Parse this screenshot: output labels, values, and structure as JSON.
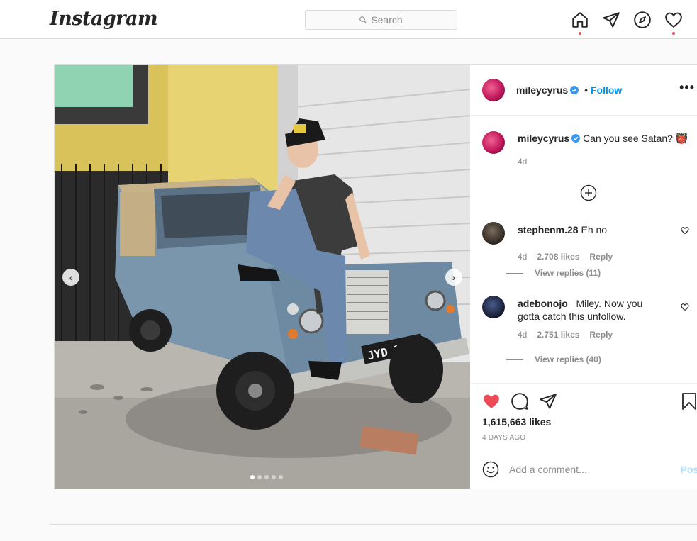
{
  "header": {
    "logo": "Instagram",
    "search_placeholder": "Search"
  },
  "post": {
    "author": "mileycyrus",
    "follow_label": "Follow",
    "more_label": "•••",
    "caption": {
      "username": "mileycyrus",
      "text": "Can you see Satan? 👹",
      "time": "4d"
    },
    "comments": [
      {
        "username": "stephenm.28",
        "text": "Eh no",
        "time": "4d",
        "likes": "2.708 likes",
        "reply": "Reply",
        "view_replies": "View replies (11)"
      },
      {
        "username": "adebonojo_",
        "text": "Miley. Now you gotta catch this unfollow.",
        "time": "4d",
        "likes": "2.751 likes",
        "reply": "Reply",
        "view_replies": "View replies (40)"
      }
    ],
    "like_count": "1,615,663 likes",
    "posted_ago": "4 DAYS AGO",
    "add_comment_placeholder": "Add a comment...",
    "post_button": "Post",
    "photo": {
      "plate": "JYD 239K",
      "carousel_count": 5,
      "carousel_active": 1
    }
  },
  "colors": {
    "accent": "#0095f6",
    "like_red": "#ed4956",
    "border": "#dbdbdb"
  }
}
